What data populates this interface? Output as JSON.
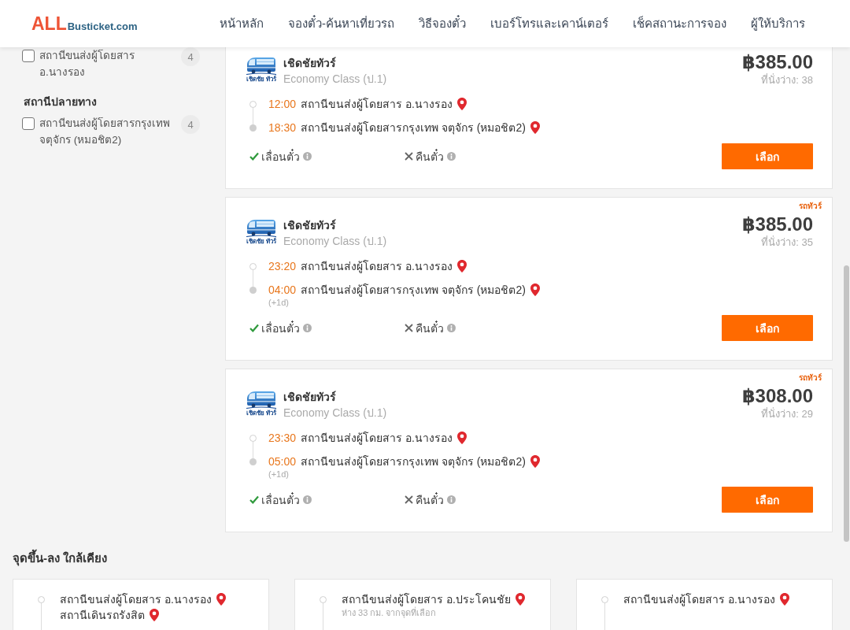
{
  "header": {
    "logo": {
      "mark": "ALL",
      "name": "Busticket.com"
    },
    "nav": [
      {
        "label": "หน้าหลัก"
      },
      {
        "label": "จองตั๋ว-ค้นหาเที่ยวรถ"
      },
      {
        "label": "วิธีจองตั๋ว"
      },
      {
        "label": "เบอร์โทรและเคาน์เตอร์"
      },
      {
        "label": "เช็คสถานะการจอง"
      },
      {
        "label": "ผู้ให้บริการ"
      }
    ]
  },
  "sidebar": {
    "groups": [
      {
        "items": [
          {
            "label": "สถานีขนส่งผู้โดยสาร อ.นางรอง",
            "count": "4",
            "checked": false
          }
        ]
      },
      {
        "heading": "สถานีปลายทาง",
        "items": [
          {
            "label": "สถานีขนส่งผู้โดยสารกรุงเทพ จตุจักร (หมอชิต2)",
            "count": "4",
            "checked": false
          }
        ]
      }
    ]
  },
  "trips": [
    {
      "operator": "เชิดชัยทัวร์",
      "logo_caption": "เชิดชัย ทัวร์",
      "class": "Economy Class (ป.1)",
      "price": "฿385.00",
      "seats": "ที่นั่งว่าง: 38",
      "stops": [
        {
          "kind": "origin",
          "time": "12:00",
          "station": "สถานีขนส่งผู้โดยสาร อ.นางรอง"
        },
        {
          "kind": "destination",
          "time": "18:30",
          "station": "สถานีขนส่งผู้โดยสารกรุงเทพ จตุจักร (หมอชิต2)"
        }
      ],
      "features": [
        {
          "label": "เลื่อนตั๋ว",
          "available": true
        },
        {
          "label": "คืนตั๋ว",
          "available": false
        }
      ],
      "button": "เลือก"
    },
    {
      "badge": "รถทัวร์",
      "operator": "เชิดชัยทัวร์",
      "logo_caption": "เชิดชัย ทัวร์",
      "class": "Economy Class (ป.1)",
      "price": "฿385.00",
      "seats": "ที่นั่งว่าง: 35",
      "stops": [
        {
          "kind": "origin",
          "time": "23:20",
          "station": "สถานีขนส่งผู้โดยสาร อ.นางรอง"
        },
        {
          "kind": "destination",
          "time": "04:00",
          "station": "สถานีขนส่งผู้โดยสารกรุงเทพ จตุจักร (หมอชิต2)",
          "day_offset": "(+1d)"
        }
      ],
      "features": [
        {
          "label": "เลื่อนตั๋ว",
          "available": true
        },
        {
          "label": "คืนตั๋ว",
          "available": false
        }
      ],
      "button": "เลือก"
    },
    {
      "badge": "รถทัวร์",
      "operator": "เชิดชัยทัวร์",
      "logo_caption": "เชิดชัย ทัวร์",
      "class": "Economy Class (ป.1)",
      "price": "฿308.00",
      "seats": "ที่นั่งว่าง: 29",
      "stops": [
        {
          "kind": "origin",
          "time": "23:30",
          "station": "สถานีขนส่งผู้โดยสาร อ.นางรอง"
        },
        {
          "kind": "destination",
          "time": "05:00",
          "station": "สถานีขนส่งผู้โดยสารกรุงเทพ จตุจักร (หมอชิต2)",
          "day_offset": "(+1d)"
        }
      ],
      "features": [
        {
          "label": "เลื่อนตั๋ว",
          "available": true
        },
        {
          "label": "คืนตั๋ว",
          "available": false
        }
      ],
      "button": "เลือก"
    }
  ],
  "nearby": {
    "title": "จุดขึ้น-ลง ใกล้เคียง",
    "cards": [
      {
        "stops": [
          {
            "name": "สถานีขนส่งผู้โดยสาร อ.นางรอง"
          },
          {
            "name": "สถานีเดินรถรังสิต"
          }
        ]
      },
      {
        "stops": [
          {
            "name": "สถานีขนส่งผู้โดยสาร อ.ประโคนชัย",
            "distance": "ห่าง 33 กม. จากจุดที่เลือก"
          }
        ]
      },
      {
        "stops": [
          {
            "name": "สถานีขนส่งผู้โดยสาร อ.นางรอง"
          }
        ]
      }
    ]
  }
}
